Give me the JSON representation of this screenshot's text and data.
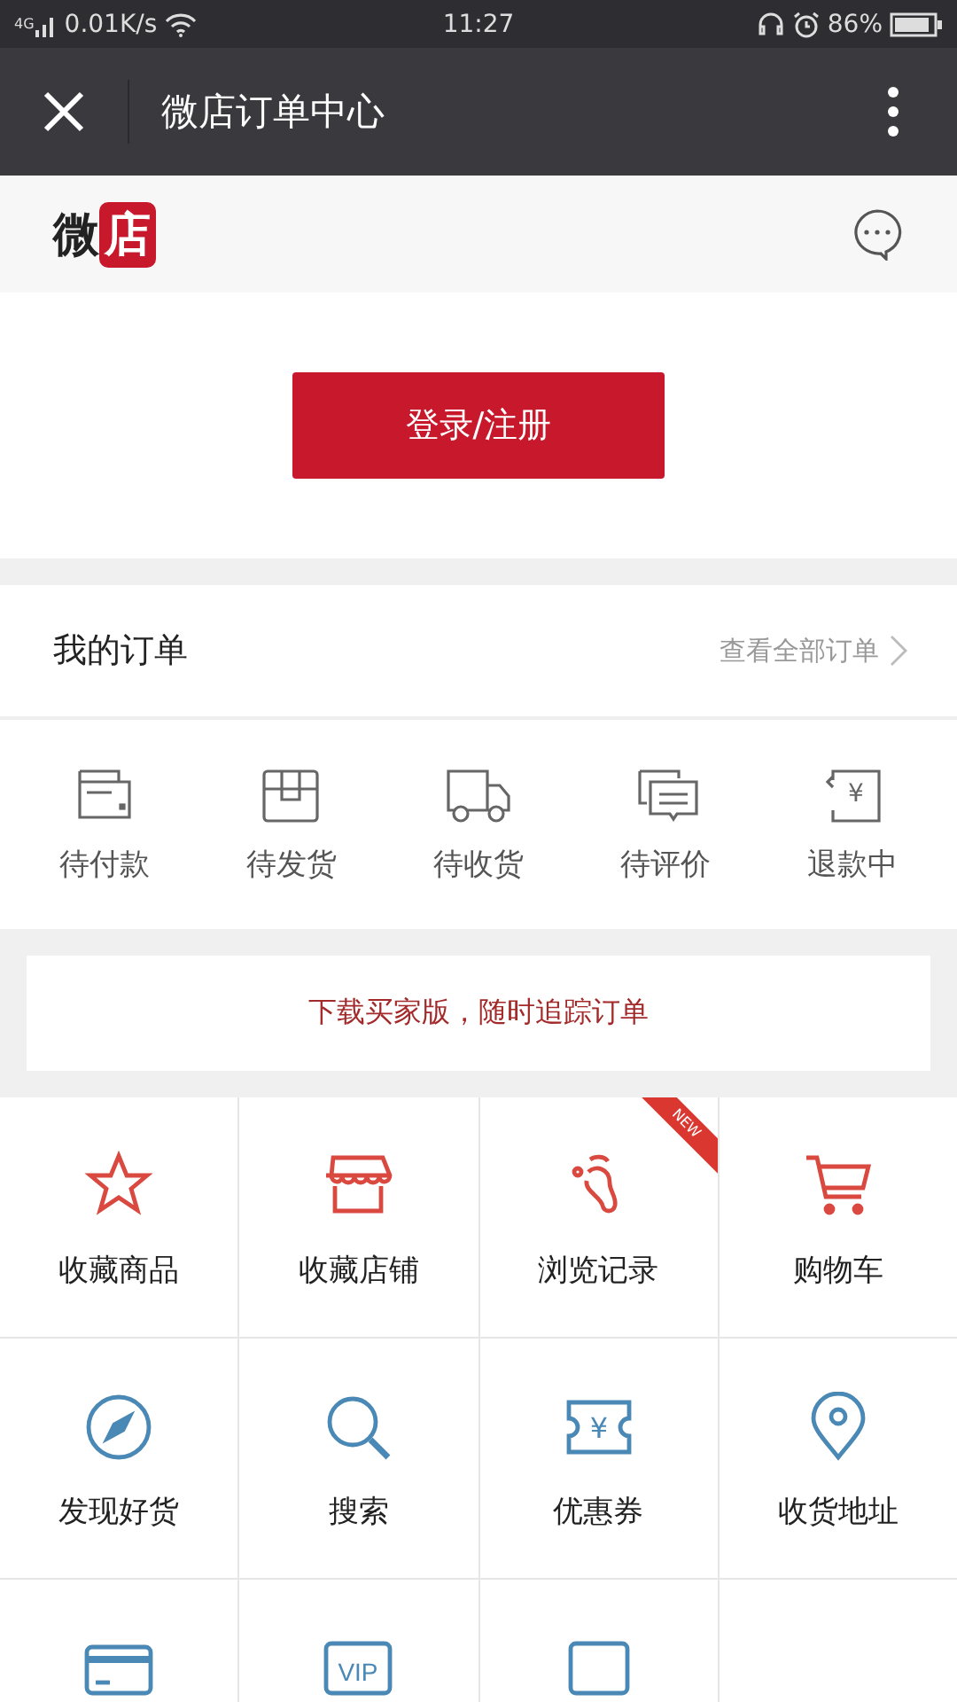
{
  "status_bar": {
    "network": "4G",
    "speed": "0.01K/s",
    "time": "11:27",
    "battery": "86%"
  },
  "nav": {
    "title": "微店订单中心"
  },
  "header": {
    "logo_text": "微",
    "logo_badge": "店"
  },
  "login_button": "登录/注册",
  "orders": {
    "title": "我的订单",
    "view_all": "查看全部订单",
    "statuses": [
      {
        "kind": "wallet",
        "label": "待付款"
      },
      {
        "kind": "box",
        "label": "待发货"
      },
      {
        "kind": "truck",
        "label": "待收货"
      },
      {
        "kind": "chat",
        "label": "待评价"
      },
      {
        "kind": "refund",
        "label": "退款中",
        "icon_text": "¥"
      }
    ]
  },
  "banner": "下载买家版，随时追踪订单",
  "grid": [
    {
      "kind": "star",
      "label": "收藏商品",
      "color": "#d9493f"
    },
    {
      "kind": "store",
      "label": "收藏店铺",
      "color": "#d9493f"
    },
    {
      "kind": "footprint",
      "label": "浏览记录",
      "color": "#d9493f",
      "badge": "NEW"
    },
    {
      "kind": "cart",
      "label": "购物车",
      "color": "#d9493f"
    },
    {
      "kind": "compass",
      "label": "发现好货",
      "color": "#4a88b5"
    },
    {
      "kind": "search",
      "label": "搜索",
      "color": "#4a88b5"
    },
    {
      "kind": "ticket",
      "label": "优惠券",
      "color": "#4a88b5",
      "icon_text": "¥"
    },
    {
      "kind": "pin",
      "label": "收货地址",
      "color": "#4a88b5"
    },
    {
      "kind": "card",
      "color": "#4a88b5"
    },
    {
      "kind": "vip",
      "color": "#4a88b5",
      "icon_text": "VIP"
    },
    {
      "kind": "frame",
      "color": "#4a88b5"
    },
    {
      "kind": "none"
    }
  ]
}
